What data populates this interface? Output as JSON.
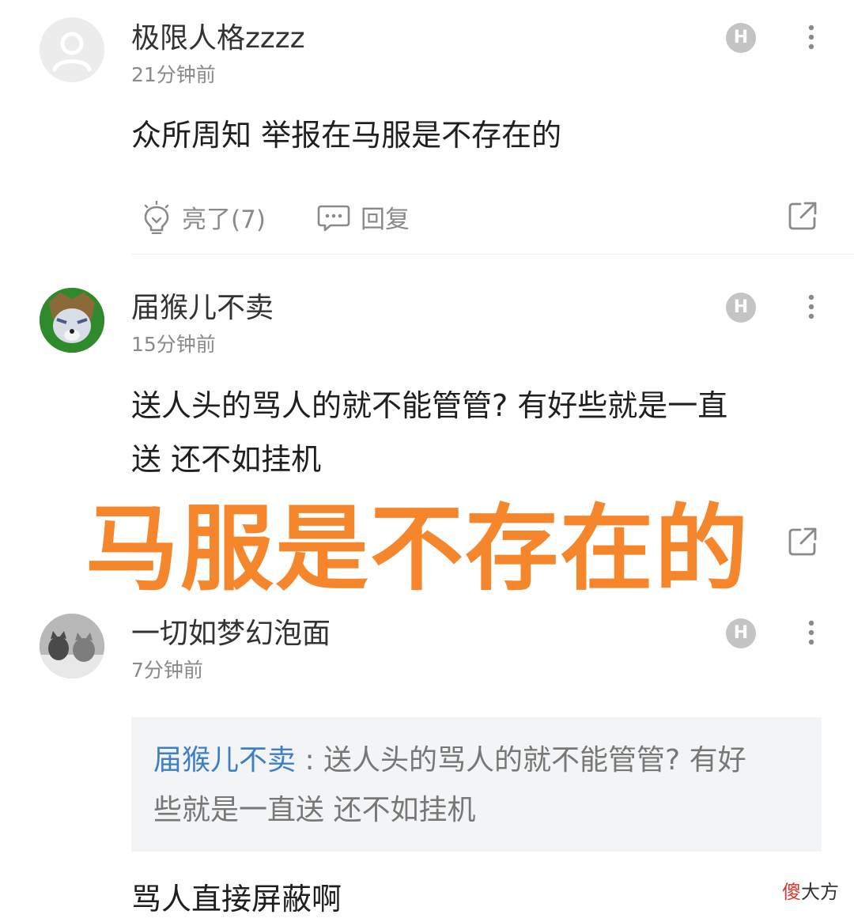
{
  "comments": [
    {
      "username": "极限人格zzzz",
      "time": "21分钟前",
      "text_lines": [
        "众所周知 举报在马服是不存在的"
      ],
      "badge": "H",
      "like_label": "亮了(7)",
      "reply_label": "回复"
    },
    {
      "username": "届猴儿不卖",
      "time": "15分钟前",
      "text_lines": [
        "送人头的骂人的就不能管管? 有好些就是一直",
        "送 还不如挂机"
      ],
      "badge": "H"
    },
    {
      "username": "一切如梦幻泡面",
      "time": "7分钟前",
      "badge": "H",
      "quote": {
        "author": "届猴儿不卖",
        "separator": " : ",
        "line1": "送人头的骂人的就不能管管? 有好",
        "line2": "些就是一直送 还不如挂机"
      },
      "text_lines": [
        "骂人直接屏蔽啊"
      ]
    }
  ],
  "overlay_caption": "马服是不存在的",
  "watermark": {
    "red_part": "傻",
    "dark_part": "大方"
  },
  "colors": {
    "overlay": "#f5862b",
    "quote_author": "#3f7fc7",
    "badge": "#c4c4c4"
  },
  "icons": [
    "avatar-placeholder-icon",
    "lightbulb-icon",
    "chat-bubble-icon",
    "share-icon",
    "more-vertical-icon"
  ]
}
